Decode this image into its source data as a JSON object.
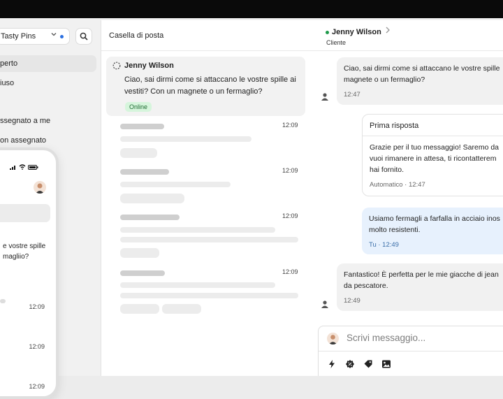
{
  "sidebar": {
    "store_name": "Tasty Pins",
    "nav": [
      "perto",
      "iuso",
      "ssegnato a me",
      "on assegnato"
    ]
  },
  "phone": {
    "message_line1": "e vostre spille",
    "message_line2": "magliio?",
    "times": [
      "12:09",
      "12:09",
      "12:09"
    ]
  },
  "inbox": {
    "title": "Casella di posta",
    "active_conversation": {
      "name": "Jenny Wilson",
      "preview": "Ciao, sai dirmi come si attaccano le vostre spille ai vestiti? Con un magnete o un fermaglio?",
      "status": "Online"
    },
    "placeholder_times": [
      "12:09",
      "12:09",
      "12:09",
      "12:09"
    ]
  },
  "chat": {
    "contact_name": "Jenny Wilson",
    "contact_role": "Cliente",
    "messages": [
      {
        "text": "Ciao, sai dirmi come si attaccano le vostre spille magnete o un fermaglio?",
        "time": "12:47"
      },
      {
        "heading": "Prima risposta",
        "text": "Grazie per il tuo messaggio! Saremo da vuoi rimanere in attesa, ti ricontatterem hai fornito.",
        "meta": "Automatico · 12:47"
      },
      {
        "text": "Usiamo fermagli a farfalla in acciaio inos molto resistenti.",
        "meta": "Tu · 12:49"
      },
      {
        "text": "Fantastico! È perfetta per le mie giacche di jean da pescatore.",
        "time": "12:49"
      }
    ],
    "composer_placeholder": "Scrivi messaggio..."
  },
  "colors": {
    "online": "#1e9a4a",
    "badge_bg": "#d6f5dc",
    "my_bubble": "#e7f1fd",
    "unread_dot": "#2b6fe0"
  },
  "icons": [
    "search-icon",
    "chevron-down-icon",
    "spinner-icon",
    "person-icon",
    "bolt-icon",
    "badge-icon",
    "tag-icon",
    "image-icon",
    "signal-icon",
    "wifi-icon",
    "battery-icon"
  ]
}
